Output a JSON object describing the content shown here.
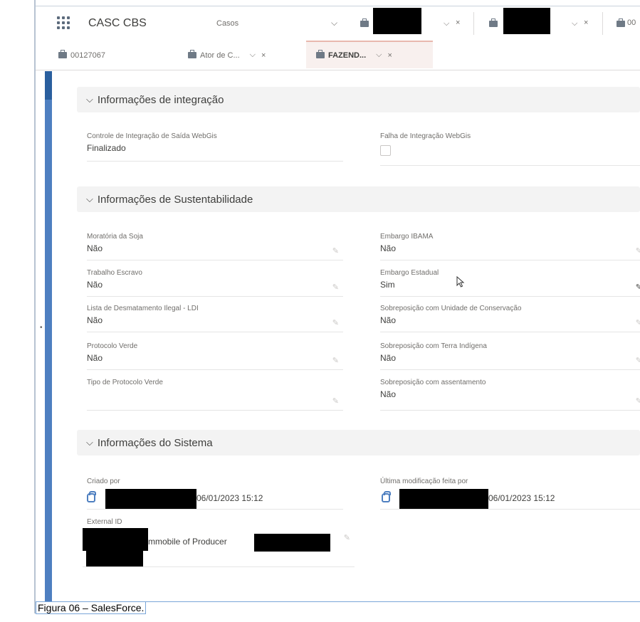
{
  "app": {
    "name": "CASC CBS"
  },
  "nav": {
    "selector_label": "Casos"
  },
  "subtabs": [
    {
      "label": "00127067"
    },
    {
      "label": "Ator de C..."
    },
    {
      "label": "FAZEND..."
    }
  ],
  "tabs_partial_label": "00",
  "sections": {
    "integracao": {
      "title": "Informações de integração",
      "fields": [
        {
          "label": "Controle de Integração de Saída WebGis",
          "value": "Finalizado"
        },
        {
          "label": "Falha de Integração WebGis",
          "value": ""
        }
      ]
    },
    "sustentabilidade": {
      "title": "Informações de Sustentabilidade",
      "left": [
        {
          "label": "Moratória da Soja",
          "value": "Não"
        },
        {
          "label": "Trabalho Escravo",
          "value": "Não"
        },
        {
          "label": "Lista de Desmatamento Ilegal - LDI",
          "value": "Não"
        },
        {
          "label": "Protocolo Verde",
          "value": "Não"
        },
        {
          "label": "Tipo de Protocolo Verde",
          "value": ""
        }
      ],
      "right": [
        {
          "label": "Embargo IBAMA",
          "value": "Não"
        },
        {
          "label": "Embargo Estadual",
          "value": "Sim"
        },
        {
          "label": "Sobreposição com Unidade de Conservação",
          "value": "Não"
        },
        {
          "label": "Sobreposição com Terra Indígena",
          "value": "Não"
        },
        {
          "label": "Sobreposição com assentamento",
          "value": "Não"
        }
      ]
    },
    "sistema": {
      "title": "Informações do Sistema",
      "created_by": {
        "label": "Criado por",
        "date": "06/01/2023 15:12"
      },
      "modified_by": {
        "label": "Última modificação feita por",
        "date": "06/01/2023 15:12"
      },
      "external_id": {
        "label": "External ID",
        "value_text": "mmobile of Producer"
      }
    }
  },
  "caption": "Figura 06 – SalesForce."
}
